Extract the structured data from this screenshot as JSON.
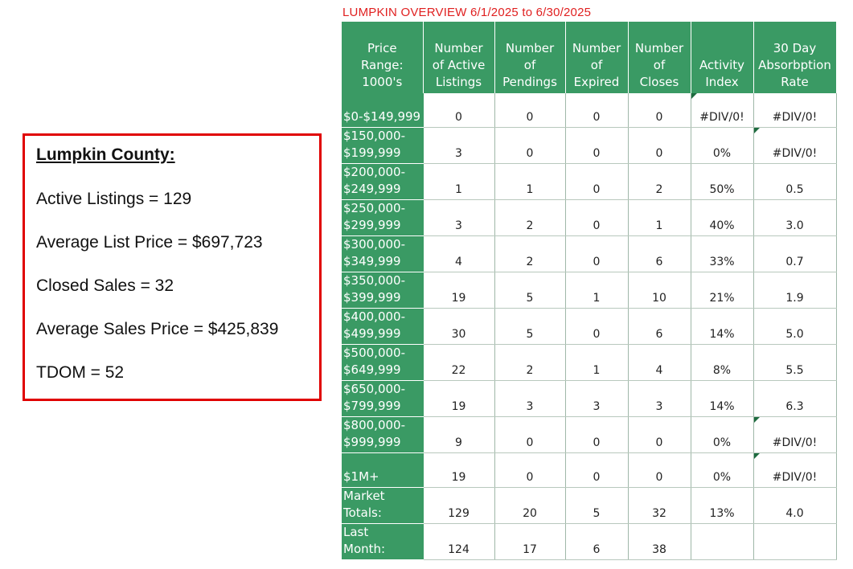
{
  "summary": {
    "title": "Lumpkin County:",
    "lines": [
      "Active Listings = 129",
      "Average List Price = $697,723",
      "Closed Sales = 32",
      "Average Sales Price = $425,839",
      "TDOM = 52"
    ]
  },
  "report": {
    "title": "LUMPKIN OVERVIEW 6/1/2025 to 6/30/2025",
    "headers": [
      [
        "Price",
        "Range:",
        "1000's"
      ],
      [
        "Number",
        "of Active",
        "Listings"
      ],
      [
        "Number",
        "of",
        "Pendings"
      ],
      [
        "Number",
        "of",
        "Expired"
      ],
      [
        "Number",
        "of",
        "Closes"
      ],
      [
        "Activity",
        "Index"
      ],
      [
        "30 Day",
        "Absorbption",
        "Rate"
      ]
    ],
    "rows": [
      {
        "range": [
          "$0-$149,999"
        ],
        "active": "0",
        "pendings": "0",
        "expired": "0",
        "closes": "0",
        "activity": "#DIV/0!",
        "absorption": "#DIV/0!"
      },
      {
        "range": [
          "$150,000-",
          "$199,999"
        ],
        "active": "3",
        "pendings": "0",
        "expired": "0",
        "closes": "0",
        "activity": "0%",
        "absorption": "#DIV/0!"
      },
      {
        "range": [
          "$200,000-",
          "$249,999"
        ],
        "active": "1",
        "pendings": "1",
        "expired": "0",
        "closes": "2",
        "activity": "50%",
        "absorption": "0.5"
      },
      {
        "range": [
          "$250,000-",
          "$299,999"
        ],
        "active": "3",
        "pendings": "2",
        "expired": "0",
        "closes": "1",
        "activity": "40%",
        "absorption": "3.0"
      },
      {
        "range": [
          "$300,000-",
          "$349,999"
        ],
        "active": "4",
        "pendings": "2",
        "expired": "0",
        "closes": "6",
        "activity": "33%",
        "absorption": "0.7"
      },
      {
        "range": [
          "$350,000-",
          "$399,999"
        ],
        "active": "19",
        "pendings": "5",
        "expired": "1",
        "closes": "10",
        "activity": "21%",
        "absorption": "1.9"
      },
      {
        "range": [
          "$400,000-",
          "$499,999"
        ],
        "active": "30",
        "pendings": "5",
        "expired": "0",
        "closes": "6",
        "activity": "14%",
        "absorption": "5.0"
      },
      {
        "range": [
          "$500,000-",
          "$649,999"
        ],
        "active": "22",
        "pendings": "2",
        "expired": "1",
        "closes": "4",
        "activity": "8%",
        "absorption": "5.5"
      },
      {
        "range": [
          "$650,000-",
          "$799,999"
        ],
        "active": "19",
        "pendings": "3",
        "expired": "3",
        "closes": "3",
        "activity": "14%",
        "absorption": "6.3"
      },
      {
        "range": [
          "$800,000-",
          "$999,999"
        ],
        "active": "9",
        "pendings": "0",
        "expired": "0",
        "closes": "0",
        "activity": "0%",
        "absorption": "#DIV/0!"
      },
      {
        "range": [
          "$1M+"
        ],
        "active": "19",
        "pendings": "0",
        "expired": "0",
        "closes": "0",
        "activity": "0%",
        "absorption": "#DIV/0!"
      },
      {
        "range": [
          "Market",
          "Totals:"
        ],
        "active": "129",
        "pendings": "20",
        "expired": "5",
        "closes": "32",
        "activity": "13%",
        "absorption": "4.0"
      },
      {
        "range": [
          "Last",
          "Month:"
        ],
        "active": "124",
        "pendings": "17",
        "expired": "6",
        "closes": "38",
        "activity": "",
        "absorption": ""
      }
    ],
    "colors": {
      "header_green": "#3a9a64",
      "title_red": "#e02020",
      "box_border": "#e00000"
    }
  }
}
